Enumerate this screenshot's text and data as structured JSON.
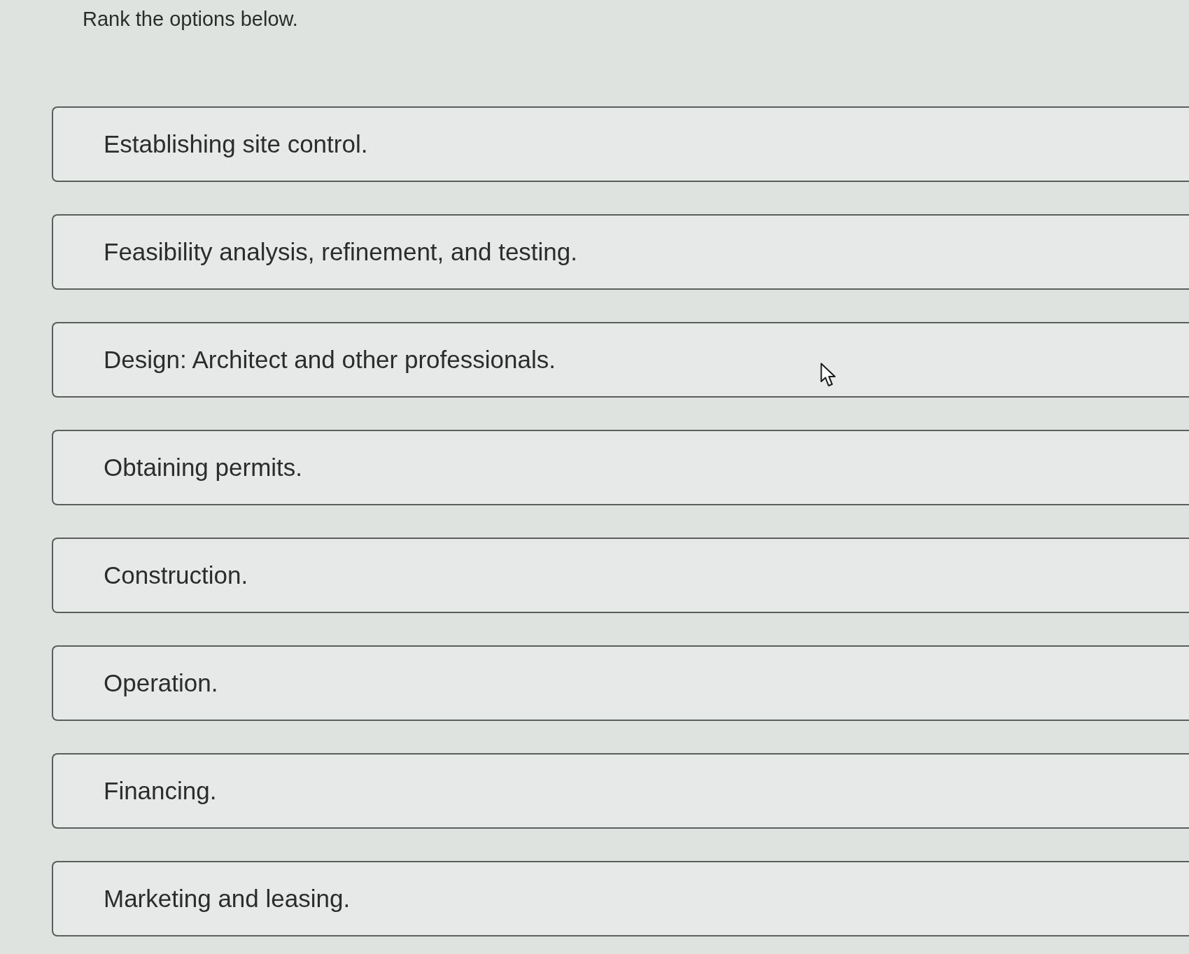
{
  "prompt": "Rank the options below.",
  "options": [
    {
      "label": "Establishing site control."
    },
    {
      "label": "Feasibility analysis, refinement, and testing."
    },
    {
      "label": "Design: Architect and other professionals."
    },
    {
      "label": "Obtaining permits."
    },
    {
      "label": "Construction."
    },
    {
      "label": "Operation."
    },
    {
      "label": "Financing."
    },
    {
      "label": "Marketing and leasing."
    }
  ]
}
